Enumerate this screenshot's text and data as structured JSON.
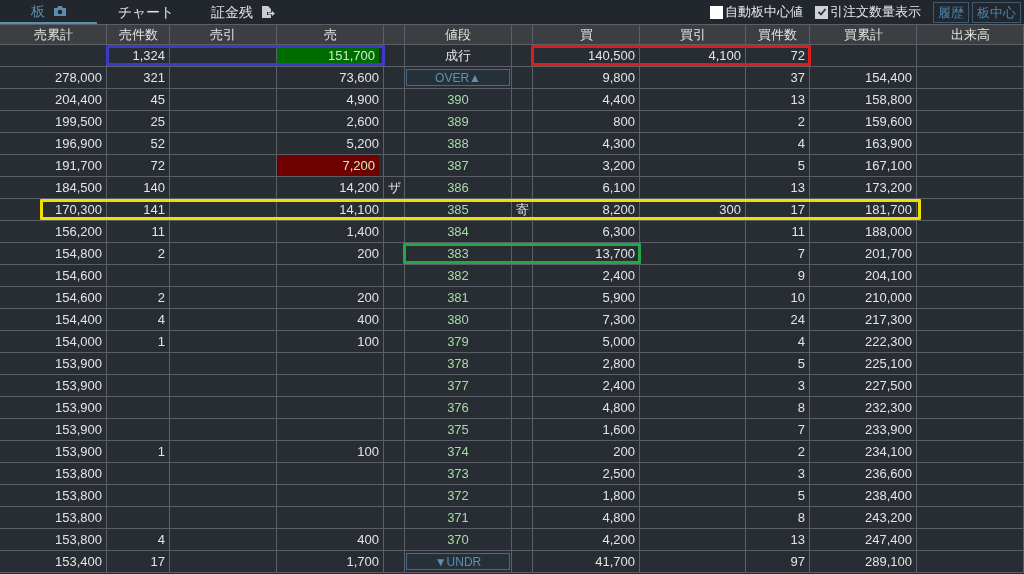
{
  "tabs": [
    {
      "label": "板",
      "selected": true
    },
    {
      "label": "チャート",
      "selected": false
    },
    {
      "label": "証金残",
      "selected": false
    }
  ],
  "options": [
    {
      "label": "自動板中心値",
      "checked": false
    },
    {
      "label": "引注文数量表示",
      "checked": true
    }
  ],
  "buttons": [
    "履歴",
    "板中心"
  ],
  "columns": [
    "売累計",
    "売件数",
    "売引",
    "売",
    "値段",
    "買",
    "買引",
    "買件数",
    "買累計",
    "出来高"
  ],
  "rows": [
    {
      "kind": "market",
      "sell_count": "1,324",
      "sell": "151,700",
      "color": "#006b00",
      "price": "成行",
      "buy": "140,500",
      "buy_cancel": "4,100",
      "buy_count": "72",
      "highlight": {
        "kind": "sell",
        "color": "#3b3bc4"
      },
      "highlight2": {
        "kind": "buy",
        "color": "#e01b1b"
      }
    },
    {
      "kind": "over",
      "sell_total": "278,000",
      "sell_count": "321",
      "sell": "73,600",
      "price": "OVER▲",
      "buy": "9,800",
      "buy_count": "37",
      "buy_total": "154,400"
    },
    {
      "kind": "price",
      "sell_total": "204,400",
      "sell_count": "45",
      "sell": "4,900",
      "price": "390",
      "buy": "4,400",
      "buy_count": "13",
      "buy_total": "158,800"
    },
    {
      "kind": "price",
      "sell_total": "199,500",
      "sell_count": "25",
      "sell": "2,600",
      "price": "389",
      "buy": "800",
      "buy_count": "2",
      "buy_total": "159,600"
    },
    {
      "kind": "price",
      "sell_total": "196,900",
      "sell_count": "52",
      "sell": "5,200",
      "price": "388",
      "buy": "4,300",
      "buy_count": "4",
      "buy_total": "163,900"
    },
    {
      "kind": "price",
      "sell_total": "191,700",
      "sell_count": "72",
      "sell": "7,200",
      "color": "#6e0000",
      "price": "387",
      "buy": "3,200",
      "buy_count": "5",
      "buy_total": "167,100"
    },
    {
      "kind": "price",
      "sell_total": "184,500",
      "sell_count": "140",
      "sell": "14,200",
      "sell_mark": "ザ",
      "price": "386",
      "buy": "6,100",
      "buy_count": "13",
      "buy_total": "173,200"
    },
    {
      "kind": "price",
      "sell_total": "170,300",
      "sell_count": "141",
      "sell": "14,100",
      "price": "385",
      "buy_mark": "寄",
      "buy": "8,200",
      "buy_cancel": "300",
      "buy_count": "17",
      "buy_total": "181,700",
      "highlight": {
        "kind": "full",
        "color": "#f0e000"
      }
    },
    {
      "kind": "price",
      "sell_total": "156,200",
      "sell_count": "11",
      "sell": "1,400",
      "price": "384",
      "buy": "6,300",
      "buy_count": "11",
      "buy_total": "188,000"
    },
    {
      "kind": "price",
      "sell_total": "154,800",
      "sell_count": "2",
      "sell": "200",
      "price": "383",
      "buy": "13,700",
      "buy_count": "7",
      "buy_total": "201,700",
      "highlight": {
        "kind": "price_buy",
        "color": "#22a845"
      }
    },
    {
      "kind": "price",
      "sell_total": "154,600",
      "price": "382",
      "buy": "2,400",
      "buy_count": "9",
      "buy_total": "204,100"
    },
    {
      "kind": "price",
      "sell_total": "154,600",
      "sell_count": "2",
      "sell": "200",
      "price": "381",
      "buy": "5,900",
      "buy_count": "10",
      "buy_total": "210,000"
    },
    {
      "kind": "price",
      "sell_total": "154,400",
      "sell_count": "4",
      "sell": "400",
      "price": "380",
      "buy": "7,300",
      "buy_count": "24",
      "buy_total": "217,300"
    },
    {
      "kind": "price",
      "sell_total": "154,000",
      "sell_count": "1",
      "sell": "100",
      "price": "379",
      "buy": "5,000",
      "buy_count": "4",
      "buy_total": "222,300"
    },
    {
      "kind": "price",
      "sell_total": "153,900",
      "price": "378",
      "buy": "2,800",
      "buy_count": "5",
      "buy_total": "225,100"
    },
    {
      "kind": "price",
      "sell_total": "153,900",
      "price": "377",
      "buy": "2,400",
      "buy_count": "3",
      "buy_total": "227,500"
    },
    {
      "kind": "price",
      "sell_total": "153,900",
      "price": "376",
      "buy": "4,800",
      "buy_count": "8",
      "buy_total": "232,300"
    },
    {
      "kind": "price",
      "sell_total": "153,900",
      "price": "375",
      "buy": "1,600",
      "buy_count": "7",
      "buy_total": "233,900"
    },
    {
      "kind": "price",
      "sell_total": "153,900",
      "sell_count": "1",
      "sell": "100",
      "price": "374",
      "buy": "200",
      "buy_count": "2",
      "buy_total": "234,100"
    },
    {
      "kind": "price",
      "sell_total": "153,800",
      "price": "373",
      "buy": "2,500",
      "buy_count": "3",
      "buy_total": "236,600"
    },
    {
      "kind": "price",
      "sell_total": "153,800",
      "price": "372",
      "buy": "1,800",
      "buy_count": "5",
      "buy_total": "238,400"
    },
    {
      "kind": "price",
      "sell_total": "153,800",
      "price": "371",
      "buy": "4,800",
      "buy_count": "8",
      "buy_total": "243,200"
    },
    {
      "kind": "price",
      "sell_total": "153,800",
      "sell_count": "4",
      "sell": "400",
      "price": "370",
      "buy": "4,200",
      "buy_count": "13",
      "buy_total": "247,400"
    },
    {
      "kind": "under",
      "sell_total": "153,400",
      "sell_count": "17",
      "sell": "1,700",
      "price": "▼UNDR",
      "buy": "41,700",
      "buy_count": "97",
      "buy_total": "289,100"
    }
  ]
}
